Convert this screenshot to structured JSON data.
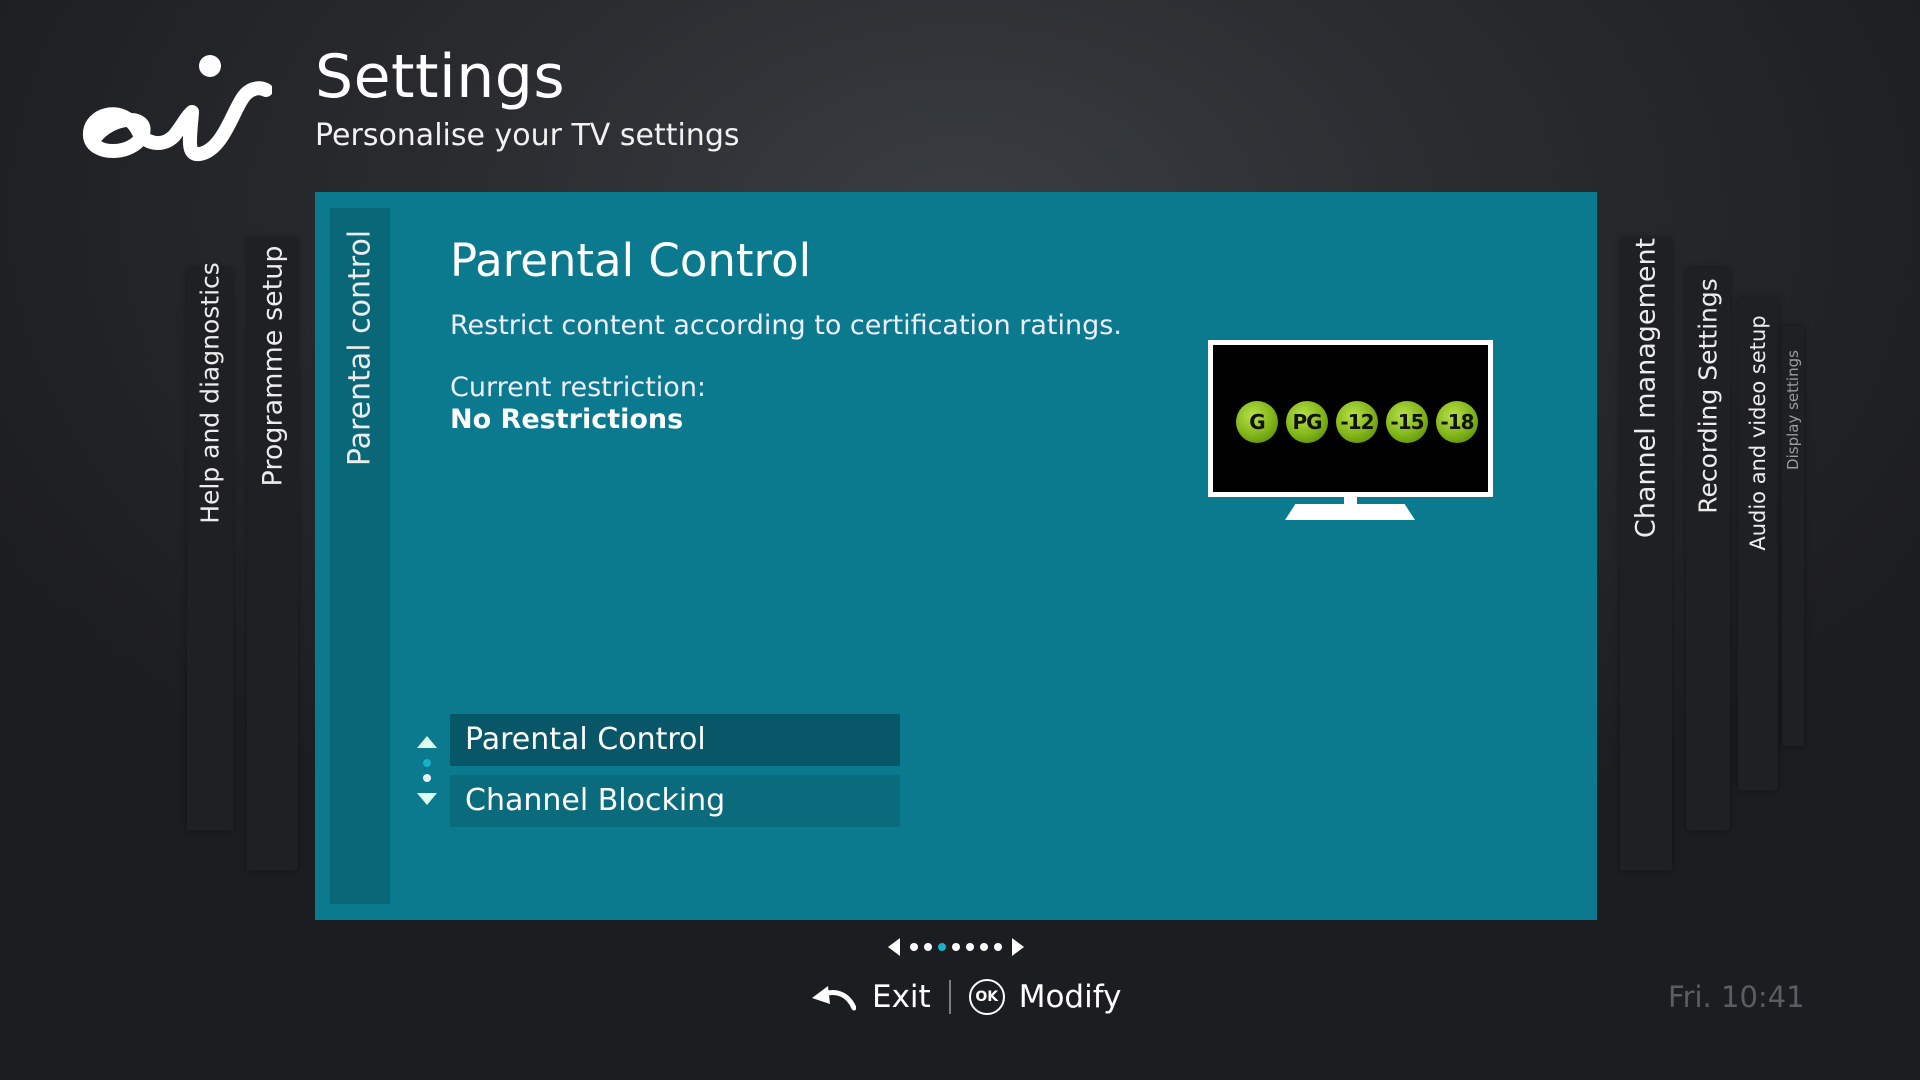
{
  "header": {
    "logo_text": "eir",
    "title": "Settings",
    "subtitle": "Personalise your TV settings"
  },
  "left_tabs": [
    {
      "label": "Help and diagnostics"
    },
    {
      "label": "Programme setup"
    }
  ],
  "right_tabs": [
    {
      "label": "Channel management"
    },
    {
      "label": "Recording Settings"
    },
    {
      "label": "Audio and video setup"
    },
    {
      "label": "Display settings"
    }
  ],
  "active_tab": {
    "label": "Parental control"
  },
  "panel": {
    "title": "Parental Control",
    "description": "Restrict content according to certification ratings.",
    "current_label": "Current restriction:",
    "current_value": "No Restrictions",
    "ratings": [
      "G",
      "PG",
      "-12",
      "-15",
      "-18"
    ]
  },
  "menu": {
    "items": [
      {
        "label": "Parental Control",
        "selected": true
      },
      {
        "label": "Channel Blocking",
        "selected": false
      }
    ]
  },
  "pager": {
    "total": 7,
    "active_index": 2
  },
  "footer": {
    "exit_label": "Exit",
    "ok_badge": "OK",
    "modify_label": "Modify",
    "clock": "Fri. 10:41"
  },
  "colors": {
    "panel": "#0b7a8f",
    "tabstrip": "#0a6777",
    "selected_item": "#075769",
    "rating_badge": "#8cc21c"
  }
}
